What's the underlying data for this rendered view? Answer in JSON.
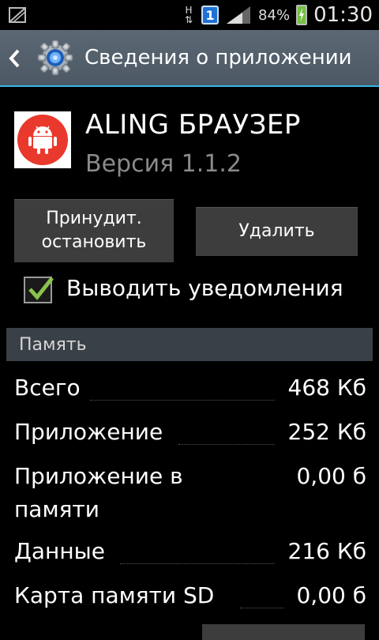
{
  "status_bar": {
    "network": "H",
    "badge": "1",
    "battery": "84%",
    "time": "01:30"
  },
  "header": {
    "title": "Сведения о приложении"
  },
  "app": {
    "name": "ALING БРАУЗЕР",
    "version": "Версия 1.1.2",
    "icon_color": "#e8392c"
  },
  "buttons": {
    "force_stop_line1": "Принудит.",
    "force_stop_line2": "остановить",
    "delete": "Удалить"
  },
  "notifications": {
    "label": "Выводить уведомления",
    "checked": true
  },
  "memory": {
    "section_title": "Память",
    "rows": [
      {
        "label": "Всего",
        "value": "468 Кб"
      },
      {
        "label": "Приложение",
        "value": "252 Кб"
      },
      {
        "label": "Приложение в",
        "label2": "памяти",
        "value": "0,00 б"
      },
      {
        "label": "Данные",
        "value": "216 Кб"
      },
      {
        "label": "Карта памяти SD",
        "value": "0,00 б"
      }
    ]
  },
  "colors": {
    "accent": "#33b5e5",
    "titlebar": "#56636e",
    "check": "#8bc34a"
  }
}
